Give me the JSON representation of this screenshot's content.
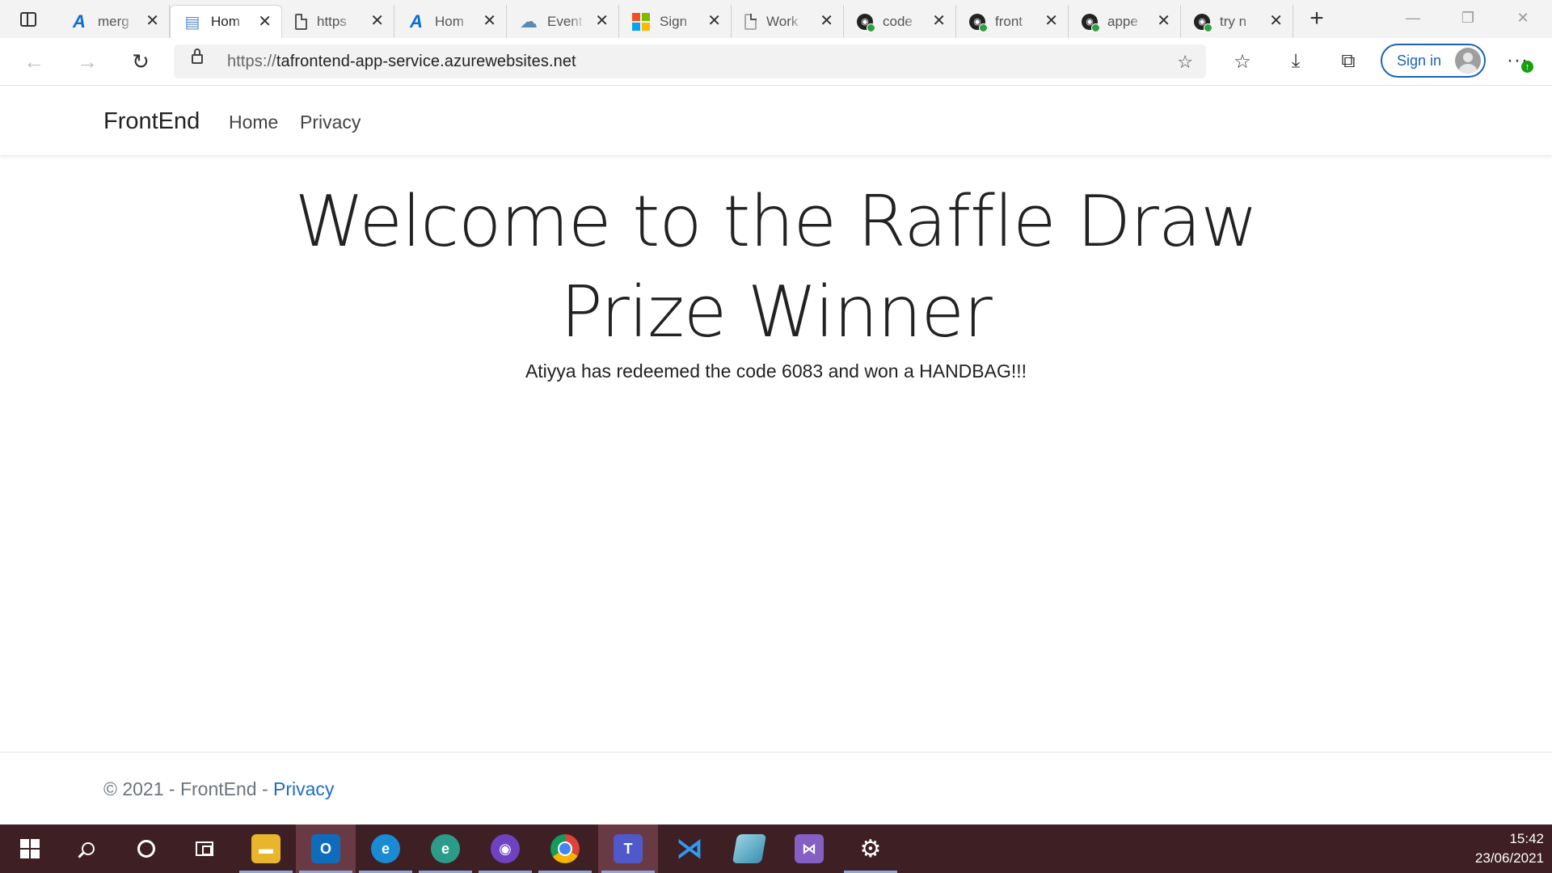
{
  "browser": {
    "tabs": [
      {
        "title": "merg",
        "icon": "azure-icon",
        "active": false
      },
      {
        "title": "Hom",
        "icon": "page-icon",
        "active": true
      },
      {
        "title": "https",
        "icon": "document-icon",
        "active": false
      },
      {
        "title": "Hom",
        "icon": "azure-icon",
        "active": false
      },
      {
        "title": "Event",
        "icon": "cloud-icon",
        "active": false
      },
      {
        "title": "Sign",
        "icon": "microsoft-icon",
        "active": false
      },
      {
        "title": "Work",
        "icon": "document-icon",
        "active": false
      },
      {
        "title": "code",
        "icon": "github-icon",
        "active": false
      },
      {
        "title": "front",
        "icon": "github-icon",
        "active": false
      },
      {
        "title": "appe",
        "icon": "github-icon",
        "active": false
      },
      {
        "title": "try n",
        "icon": "github-icon",
        "active": false
      }
    ],
    "address": {
      "scheme": "https://",
      "host": "tafrontend-app-service.azurewebsites.net"
    },
    "signin_label": "Sign in"
  },
  "site": {
    "brand": "FrontEnd",
    "nav": {
      "home": "Home",
      "privacy": "Privacy"
    },
    "heading_line1": "Welcome to the Raffle Draw",
    "heading_line2": "Prize Winner",
    "winner_message": "Atiyya has redeemed the code 6083 and won a HANDBAG!!!",
    "footer": {
      "copyright": "© 2021 - FrontEnd - ",
      "privacy_link": "Privacy"
    }
  },
  "taskbar": {
    "time": "15:42",
    "date": "23/06/2021",
    "apps": [
      "file-explorer-icon",
      "outlook-icon",
      "edge-icon",
      "edge-beta-icon",
      "github-desktop-icon",
      "chrome-icon",
      "teams-icon",
      "vscode-icon",
      "azure-storage-explorer-icon",
      "visual-studio-icon",
      "settings-icon"
    ]
  },
  "colors": {
    "accent": "#1b63b7",
    "link": "#1b6ec2",
    "taskbar": "#3d1f24"
  }
}
